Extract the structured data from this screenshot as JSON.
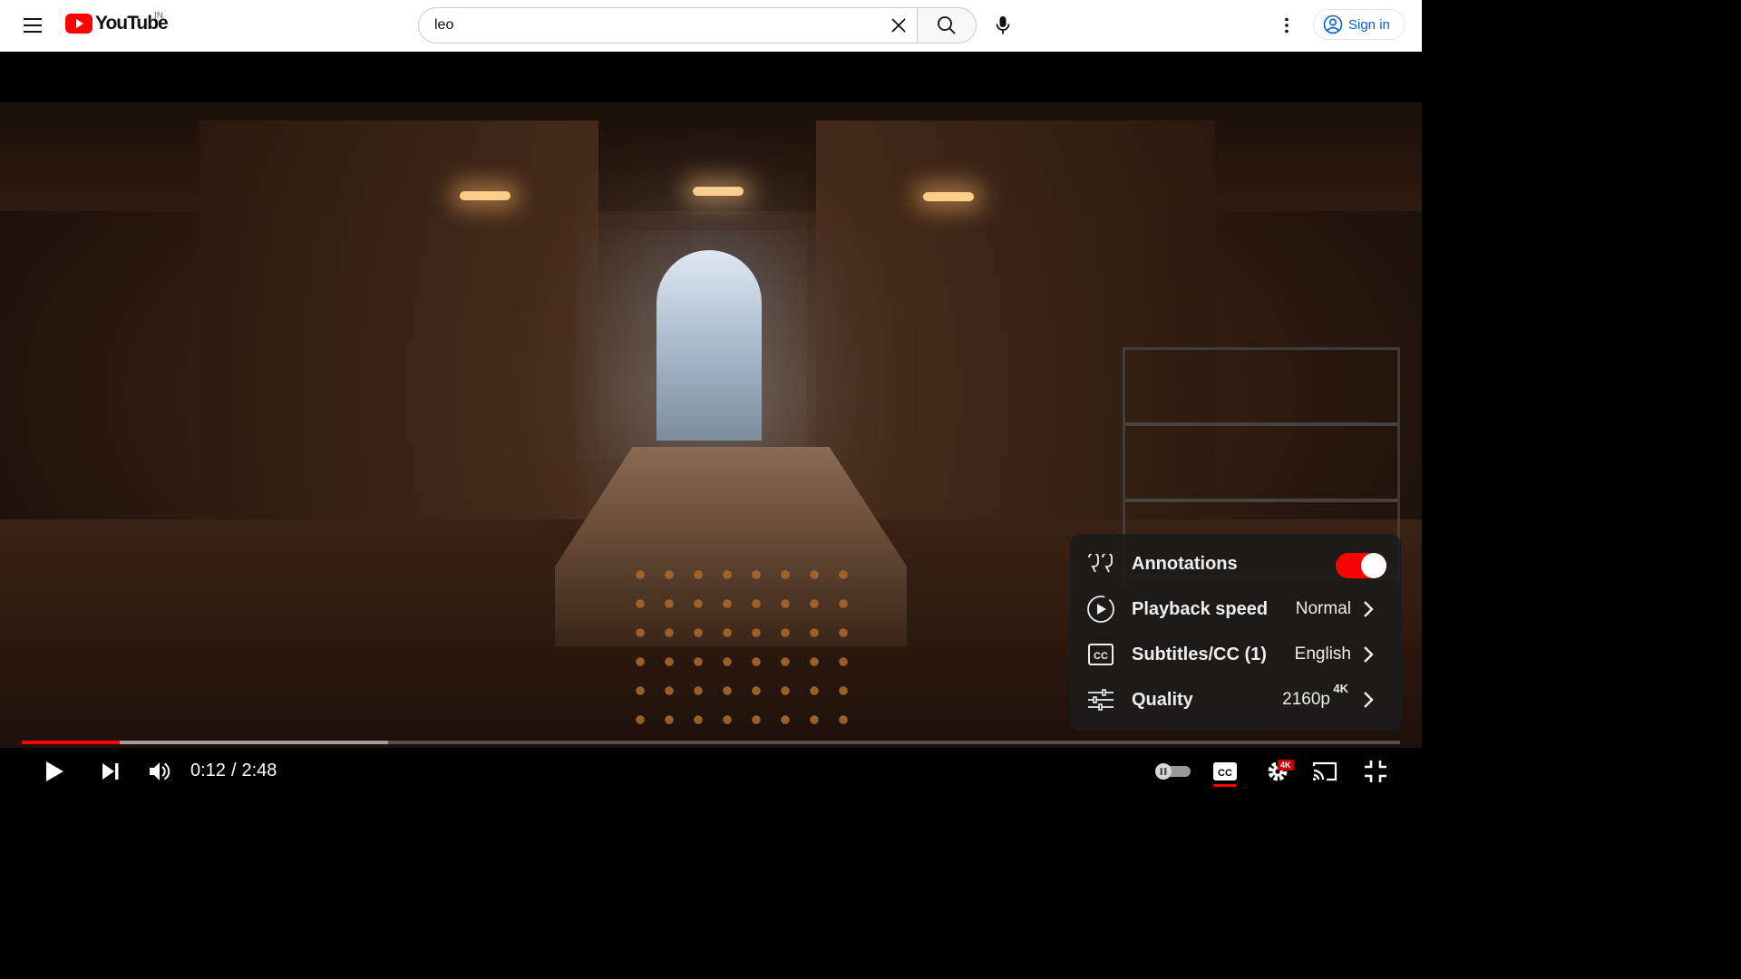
{
  "header": {
    "logo_text": "YouTube",
    "country_code": "IN",
    "search_value": "leo",
    "sign_in_label": "Sign in"
  },
  "player": {
    "current_time": "0:12",
    "time_separator": "/",
    "duration": "2:48",
    "progress_fraction": 0.071,
    "buffered_fraction": 0.266,
    "quality_badge": "4K",
    "settings": {
      "annotations_label": "Annotations",
      "annotations_on": true,
      "playback_speed_label": "Playback speed",
      "playback_speed_value": "Normal",
      "subtitles_label": "Subtitles/CC (1)",
      "subtitles_value": "English",
      "quality_label": "Quality",
      "quality_value": "2160p",
      "quality_superscript": "4K"
    }
  },
  "colors": {
    "brand_red": "#ff0000",
    "link_blue": "#065fd4",
    "menu_bg": "#1c1c1c"
  }
}
